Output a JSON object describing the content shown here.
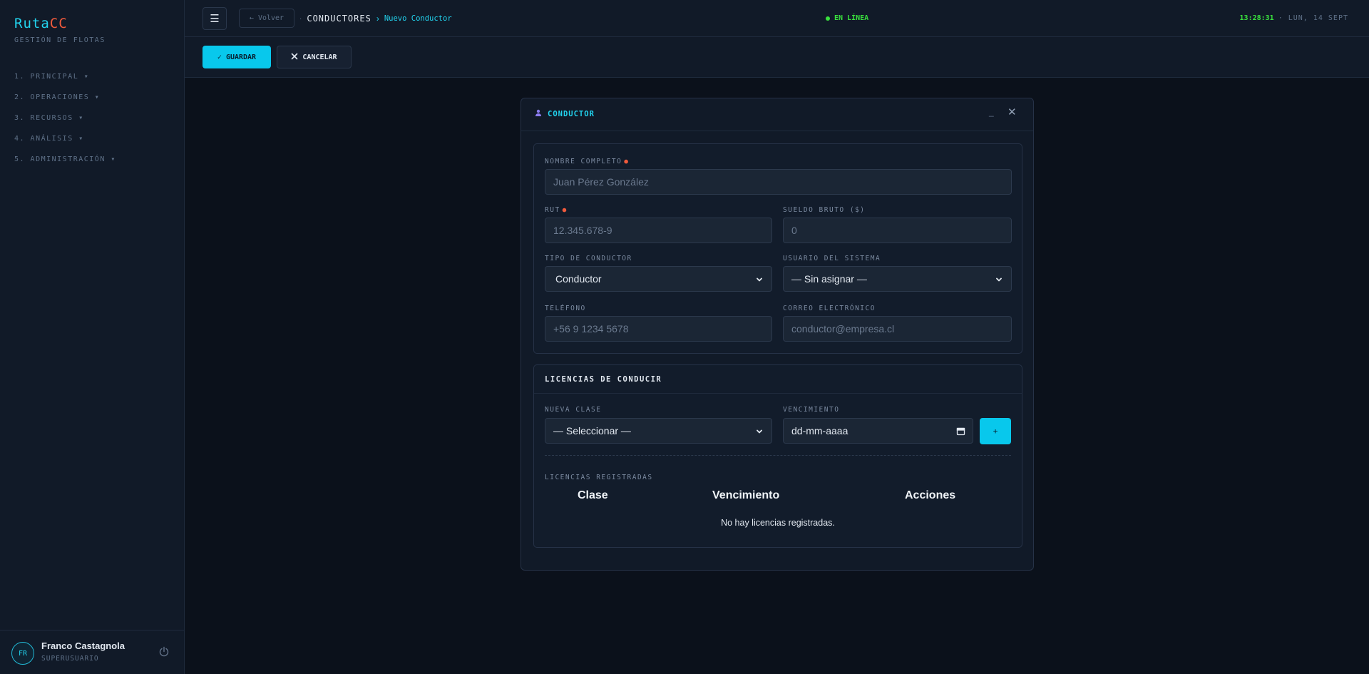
{
  "sidebar": {
    "brand_part1": "Ruta",
    "brand_part2": "CC",
    "subtitle": "GESTIÓN DE FLOTAS",
    "items": [
      {
        "label": "1. PRINCIPAL ▾"
      },
      {
        "label": "2. OPERACIONES ▾"
      },
      {
        "label": "3. RECURSOS ▾"
      },
      {
        "label": "4. ANÁLISIS ▾"
      },
      {
        "label": "5. ADMINISTRACIÓN ▾"
      }
    ],
    "user": {
      "initials": "FR",
      "name": "Franco Castagnola",
      "role": "SUPERUSUARIO"
    }
  },
  "header": {
    "back_label": "← Volver",
    "crumb_section": "CONDUCTORES",
    "crumb_current": "Nuevo Conductor",
    "status": "EN LÍNEA",
    "time": "13:28:31",
    "date": "· LUN, 14 SEPT"
  },
  "toolbar": {
    "save_label": "GUARDAR",
    "cancel_label": "CANCELAR"
  },
  "modal": {
    "title": "CONDUCTOR",
    "form": {
      "nombre_label": "NOMBRE COMPLETO",
      "nombre_placeholder": "Juan Pérez González",
      "rut_label": "RUT",
      "rut_placeholder": "12.345.678-9",
      "sueldo_label": "SUELDO BRUTO ($)",
      "sueldo_placeholder": "0",
      "tipo_label": "TIPO DE CONDUCTOR",
      "tipo_value": "Conductor",
      "usuario_label": "USUARIO DEL SISTEMA",
      "usuario_value": "— Sin asignar —",
      "telefono_label": "TELÉFONO",
      "telefono_placeholder": "+56 9 1234 5678",
      "correo_label": "CORREO ELECTRÓNICO",
      "correo_placeholder": "conductor@empresa.cl"
    },
    "licencias": {
      "title": "LICENCIAS DE CONDUCIR",
      "clase_label": "NUEVA CLASE",
      "clase_value": "— Seleccionar —",
      "venc_label": "VENCIMIENTO",
      "venc_value": "dd-mm-aaaa",
      "add_label": "+",
      "registradas_label": "LICENCIAS REGISTRADAS",
      "columns": [
        "Clase",
        "Vencimiento",
        "Acciones"
      ],
      "empty_text": "No hay licencias registradas."
    }
  },
  "colors": {
    "accent": "#08c8ec",
    "online": "#39e03d",
    "brand_secondary": "#f05a3c",
    "background": "#0b111b",
    "panel": "#111a28"
  },
  "icons": [
    "menu-icon",
    "check-icon",
    "close-icon",
    "user-icon",
    "minimize-icon",
    "chevron-down-icon",
    "calendar-icon",
    "power-icon"
  ]
}
